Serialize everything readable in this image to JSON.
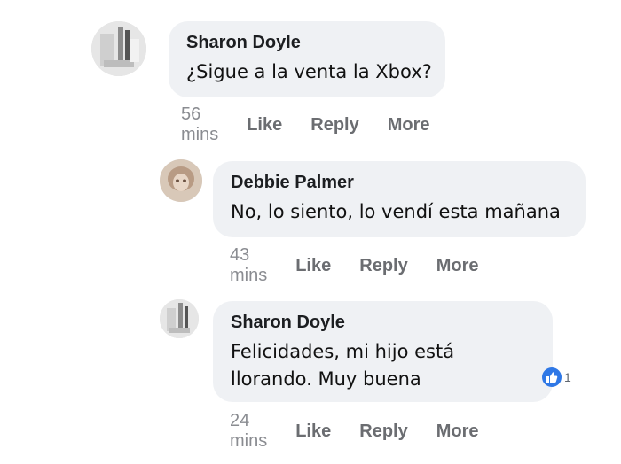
{
  "comments": [
    {
      "author": "Sharon Doyle",
      "text": "¿Sigue a la venta la Xbox?",
      "time": "56 mins",
      "like": "Like",
      "reply": "Reply",
      "more": "More"
    },
    {
      "author": "Debbie Palmer",
      "text": "No, lo siento, lo vendí esta mañana",
      "time": "43 mins",
      "like": "Like",
      "reply": "Reply",
      "more": "More"
    },
    {
      "author": "Sharon Doyle",
      "text": "Felicidades, mi hijo está\nllorando. Muy buena",
      "time": "24 mins",
      "like": "Like",
      "reply": "Reply",
      "more": "More",
      "reaction": {
        "icon": "thumbs-up-icon",
        "count": "1",
        "color": "#2f78e6"
      }
    }
  ]
}
